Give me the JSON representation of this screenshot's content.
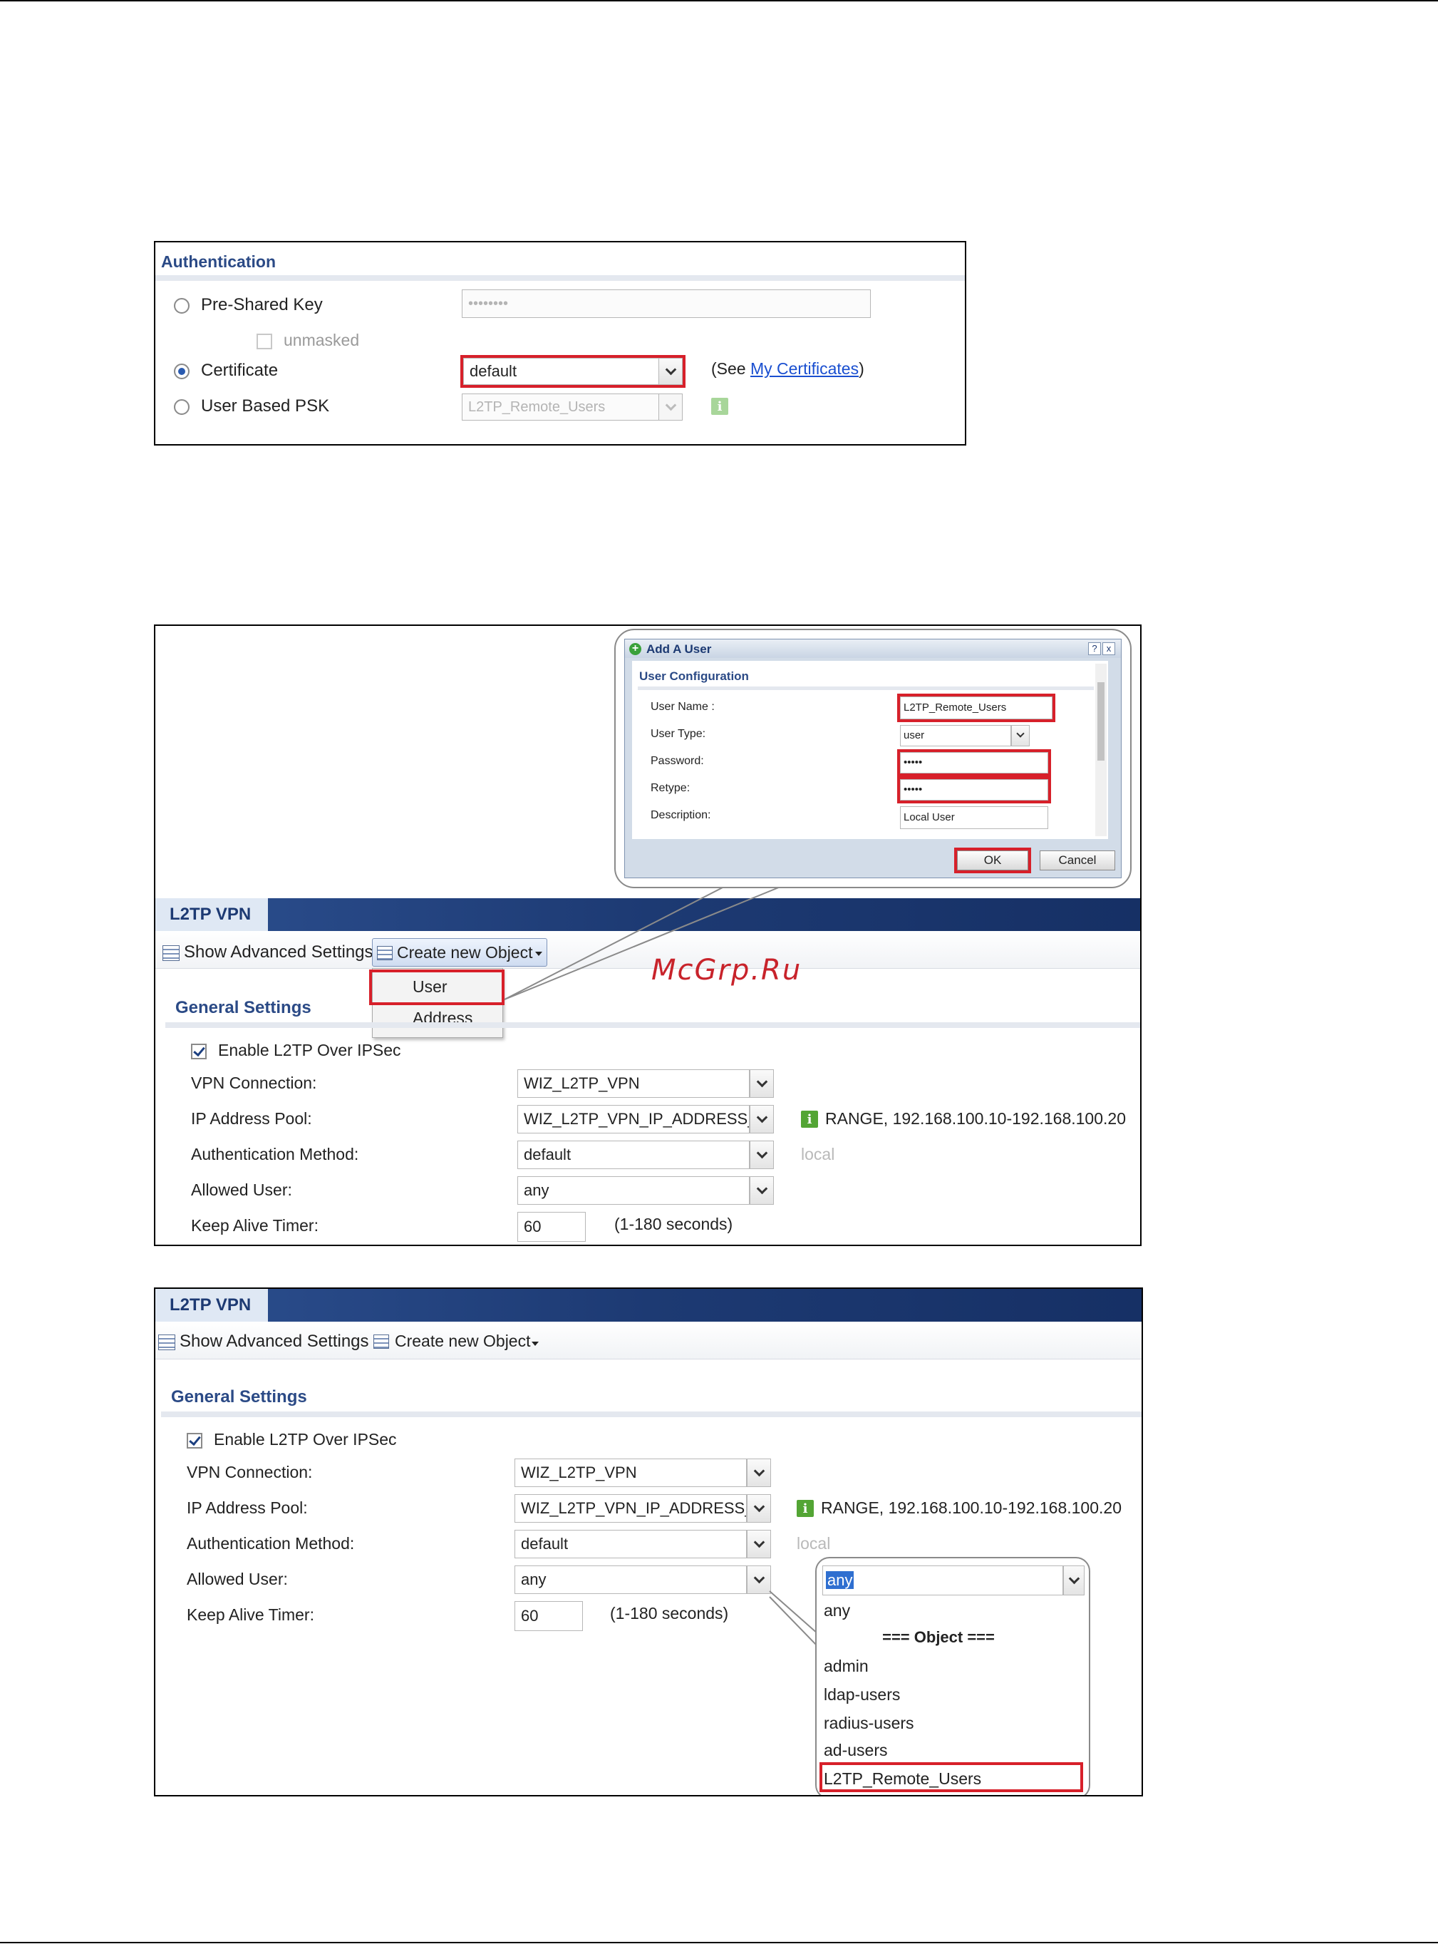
{
  "watermark": "McGrp.Ru",
  "auth_panel": {
    "title": "Authentication",
    "pre_shared_key": {
      "label": "Pre-Shared Key",
      "value": "••••••••"
    },
    "unmasked": {
      "label": "unmasked"
    },
    "certificate": {
      "label": "Certificate",
      "value": "default",
      "see_prefix": "(See ",
      "link": "My Certificates",
      "see_suffix": ")"
    },
    "user_based_psk": {
      "label": "User Based PSK",
      "value": "L2TP_Remote_Users"
    }
  },
  "add_user_dialog": {
    "title": "Add A User",
    "help": "?",
    "close": "x",
    "section": "User Configuration",
    "user_name": {
      "label": "User Name :",
      "value": "L2TP_Remote_Users"
    },
    "user_type": {
      "label": "User Type:",
      "value": "user"
    },
    "password": {
      "label": "Password:",
      "value": "•••••"
    },
    "retype": {
      "label": "Retype:",
      "value": "•••••"
    },
    "description": {
      "label": "Description:",
      "value": "Local User"
    },
    "ok": "OK",
    "cancel": "Cancel"
  },
  "l2tp_panel_1": {
    "header": "L2TP VPN",
    "toolbar": {
      "show_advanced": "Show Advanced Settings",
      "create_new": "Create new Object"
    },
    "create_menu": [
      "User",
      "Address"
    ],
    "section": "General Settings",
    "enable": "Enable L2TP Over IPSec",
    "vpn_connection": {
      "label": "VPN Connection:",
      "value": "WIZ_L2TP_VPN"
    },
    "ip_pool": {
      "label": "IP Address Pool:",
      "value": "WIZ_L2TP_VPN_IP_ADDRESS_",
      "range": "RANGE, 192.168.100.10-192.168.100.20"
    },
    "auth_method": {
      "label": "Authentication Method:",
      "value": "default",
      "hint": "local"
    },
    "allowed_user": {
      "label": "Allowed User:",
      "value": "any"
    },
    "keep_alive": {
      "label": "Keep Alive Timer:",
      "value": "60",
      "hint": "(1-180 seconds)"
    }
  },
  "l2tp_panel_2": {
    "header": "L2TP VPN",
    "toolbar": {
      "show_advanced": "Show Advanced Settings",
      "create_new": "Create new Object"
    },
    "section": "General Settings",
    "enable": "Enable L2TP Over IPSec",
    "vpn_connection": {
      "label": "VPN Connection:",
      "value": "WIZ_L2TP_VPN"
    },
    "ip_pool": {
      "label": "IP Address Pool:",
      "value": "WIZ_L2TP_VPN_IP_ADDRESS_",
      "range": "RANGE, 192.168.100.10-192.168.100.20"
    },
    "auth_method": {
      "label": "Authentication Method:",
      "value": "default",
      "hint": "local"
    },
    "allowed_user": {
      "label": "Allowed User:",
      "value": "any"
    },
    "keep_alive": {
      "label": "Keep Alive Timer:",
      "value": "60",
      "hint": "(1-180 seconds)"
    },
    "dropdown": {
      "selected": "any",
      "options": [
        "any",
        "=== Object ===",
        "admin",
        "ldap-users",
        "radius-users",
        "ad-users",
        "L2TP_Remote_Users"
      ]
    }
  }
}
